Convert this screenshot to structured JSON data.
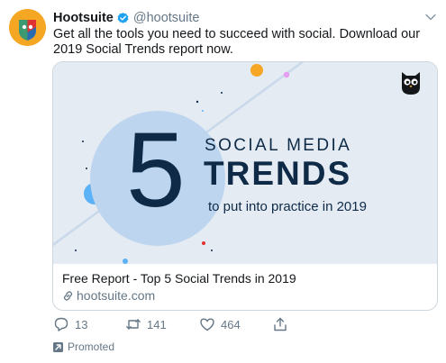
{
  "tweet": {
    "display_name": "Hootsuite",
    "handle": "@hootsuite",
    "text": "Get all the tools you need to succeed with social. Download our 2019 Social Trends report now.",
    "verified": true
  },
  "card": {
    "image": {
      "big_number": "5",
      "headline_line1": "SOCIAL MEDIA",
      "headline_line2": "TRENDS",
      "subline": "to put into practice in 2019",
      "logo_icon": "owl-logo-icon"
    },
    "title": "Free Report - Top 5 Social Trends in 2019",
    "link": "hootsuite.com"
  },
  "actions": {
    "reply_count": "13",
    "retweet_count": "141",
    "like_count": "464"
  },
  "promoted_label": "Promoted",
  "colors": {
    "accent": "#1da1f2",
    "muted": "#657786",
    "text": "#14171a",
    "card_bg": "#e4ebf3",
    "navy": "#0e2a47",
    "avatar": "#f5a623"
  }
}
